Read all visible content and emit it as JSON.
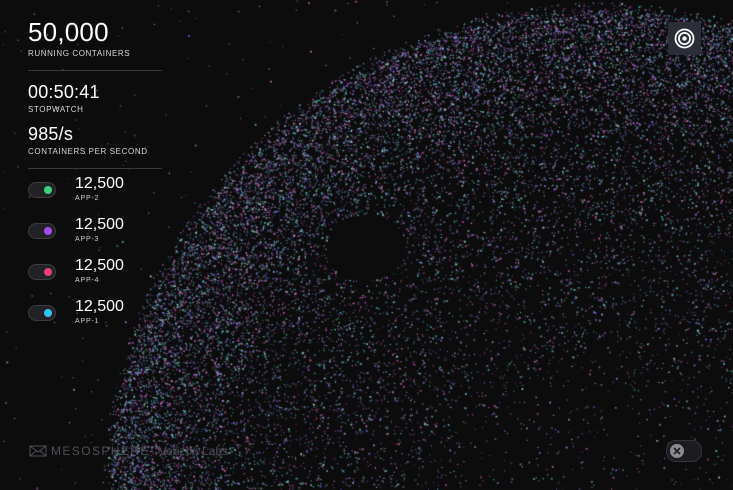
{
  "running": {
    "value": "50,000",
    "label": "RUNNING CONTAINERS"
  },
  "stopwatch": {
    "value": "00:50:41",
    "label": "STOPWATCH"
  },
  "rate": {
    "value": "985/s",
    "label": "CONTAINERS PER SECOND"
  },
  "apps": [
    {
      "count": "12,500",
      "name": "APP-2",
      "color": "#3ecf7a"
    },
    {
      "count": "12,500",
      "name": "APP-3",
      "color": "#a24cf0"
    },
    {
      "count": "12,500",
      "name": "APP-4",
      "color": "#ee3b7c"
    },
    {
      "count": "12,500",
      "name": "APP-1",
      "color": "#31c6f2"
    }
  ],
  "footer": {
    "brand": "MESOSPHERE",
    "partner": "Verizon Labs"
  },
  "icons": {
    "top_right_button": "target-icon",
    "bottom_right_toggle": "close-icon",
    "brand_logo": "mesosphere-logo-icon"
  }
}
